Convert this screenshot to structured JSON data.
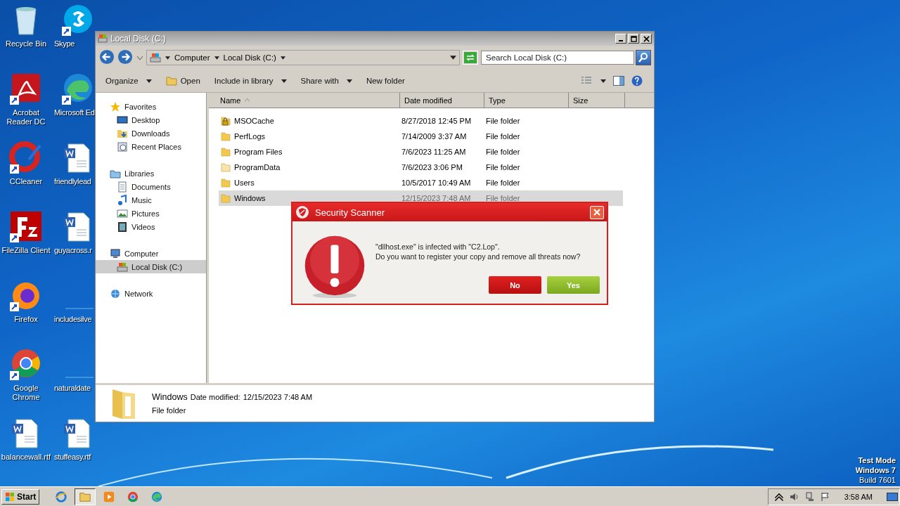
{
  "desktop_icons": [
    {
      "label": "Recycle Bin",
      "kind": "recycle"
    },
    {
      "label": "Skype",
      "kind": "skype"
    },
    {
      "label": "Acrobat Reader DC",
      "kind": "acrobat"
    },
    {
      "label": "Microsoft Ed",
      "kind": "edge"
    },
    {
      "label": "CCleaner",
      "kind": "ccleaner"
    },
    {
      "label": "friendlylead",
      "kind": "word"
    },
    {
      "label": "FileZilla Client",
      "kind": "filezilla"
    },
    {
      "label": "guyacross.r",
      "kind": "word"
    },
    {
      "label": "Firefox",
      "kind": "firefox"
    },
    {
      "label": "includesilve",
      "kind": "blank"
    },
    {
      "label": "Google Chrome",
      "kind": "chrome"
    },
    {
      "label": "naturaldate",
      "kind": "blank"
    },
    {
      "label": "balancewall.rtf",
      "kind": "word"
    },
    {
      "label": "stuffeasy.rtf",
      "kind": "word"
    }
  ],
  "desktop_notice": [
    "Test Mode",
    "Windows 7",
    "Build 7601"
  ],
  "explorer": {
    "title": "Local Disk (C:)",
    "breadcrumb": [
      "Computer",
      "Local Disk (C:)"
    ],
    "search": {
      "placeholder": "Search Local Disk (C:)"
    },
    "toolbar": [
      {
        "label": "Organize",
        "dropdown": true,
        "kind": "text"
      },
      {
        "label": "Open",
        "dropdown": false,
        "kind": "open"
      },
      {
        "label": "Include in library",
        "dropdown": true,
        "kind": "text"
      },
      {
        "label": "Share with",
        "dropdown": true,
        "kind": "text"
      },
      {
        "label": "New folder",
        "dropdown": false,
        "kind": "text"
      }
    ],
    "nav": [
      {
        "label": "Favorites",
        "kind": "star",
        "selected": false,
        "children": [
          {
            "label": "Desktop",
            "kind": "desktop",
            "selected": false
          },
          {
            "label": "Downloads",
            "kind": "downloads",
            "selected": false
          },
          {
            "label": "Recent Places",
            "kind": "recent",
            "selected": false
          }
        ]
      },
      {
        "label": "Libraries",
        "kind": "libraries",
        "selected": false,
        "children": [
          {
            "label": "Documents",
            "kind": "documents",
            "selected": false
          },
          {
            "label": "Music",
            "kind": "music",
            "selected": false
          },
          {
            "label": "Pictures",
            "kind": "pictures",
            "selected": false
          },
          {
            "label": "Videos",
            "kind": "videos",
            "selected": false
          }
        ]
      },
      {
        "label": "Computer",
        "kind": "computer",
        "selected": false,
        "children": [
          {
            "label": "Local Disk (C:)",
            "kind": "disk",
            "selected": true
          }
        ]
      },
      {
        "label": "Network",
        "kind": "network",
        "selected": false
      }
    ],
    "columns": [
      "Name",
      "Date modified",
      "Type",
      "Size"
    ],
    "rows": [
      {
        "name": "MSOCache",
        "date": "8/27/2018 12:45 PM",
        "type": "File folder",
        "kind": "locked",
        "selected": false
      },
      {
        "name": "PerfLogs",
        "date": "7/14/2009 3:37 AM",
        "type": "File folder",
        "kind": "folder",
        "selected": false
      },
      {
        "name": "Program Files",
        "date": "7/6/2023 11:25 AM",
        "type": "File folder",
        "kind": "folder",
        "selected": false
      },
      {
        "name": "ProgramData",
        "date": "7/6/2023 3:06 PM",
        "type": "File folder",
        "kind": "hidden",
        "selected": false
      },
      {
        "name": "Users",
        "date": "10/5/2017 10:49 AM",
        "type": "File folder",
        "kind": "folder",
        "selected": false
      },
      {
        "name": "Windows",
        "date": "12/15/2023 7:48 AM",
        "type": "File folder",
        "kind": "folder",
        "selected": true
      }
    ],
    "details": {
      "name": "Windows",
      "date_label": "Date modified:",
      "date": "12/15/2023 7:48 AM",
      "type": "File folder"
    }
  },
  "dialog": {
    "title": "Security Scanner",
    "lines": [
      "\"dllhost.exe\" is infected with \"C2.Lop\".",
      "Do you want to register your copy and remove all threats now?"
    ],
    "buttons": [
      {
        "label": "No",
        "kind": "no"
      },
      {
        "label": "Yes",
        "kind": "yes"
      }
    ]
  },
  "taskbar": {
    "start": "Start",
    "apps": [
      {
        "kind": "ie",
        "selected": false
      },
      {
        "kind": "explorer",
        "selected": true
      },
      {
        "kind": "media",
        "selected": false
      },
      {
        "kind": "chrome",
        "selected": false
      },
      {
        "kind": "edge",
        "selected": false
      }
    ],
    "clock": "3:58 AM"
  }
}
